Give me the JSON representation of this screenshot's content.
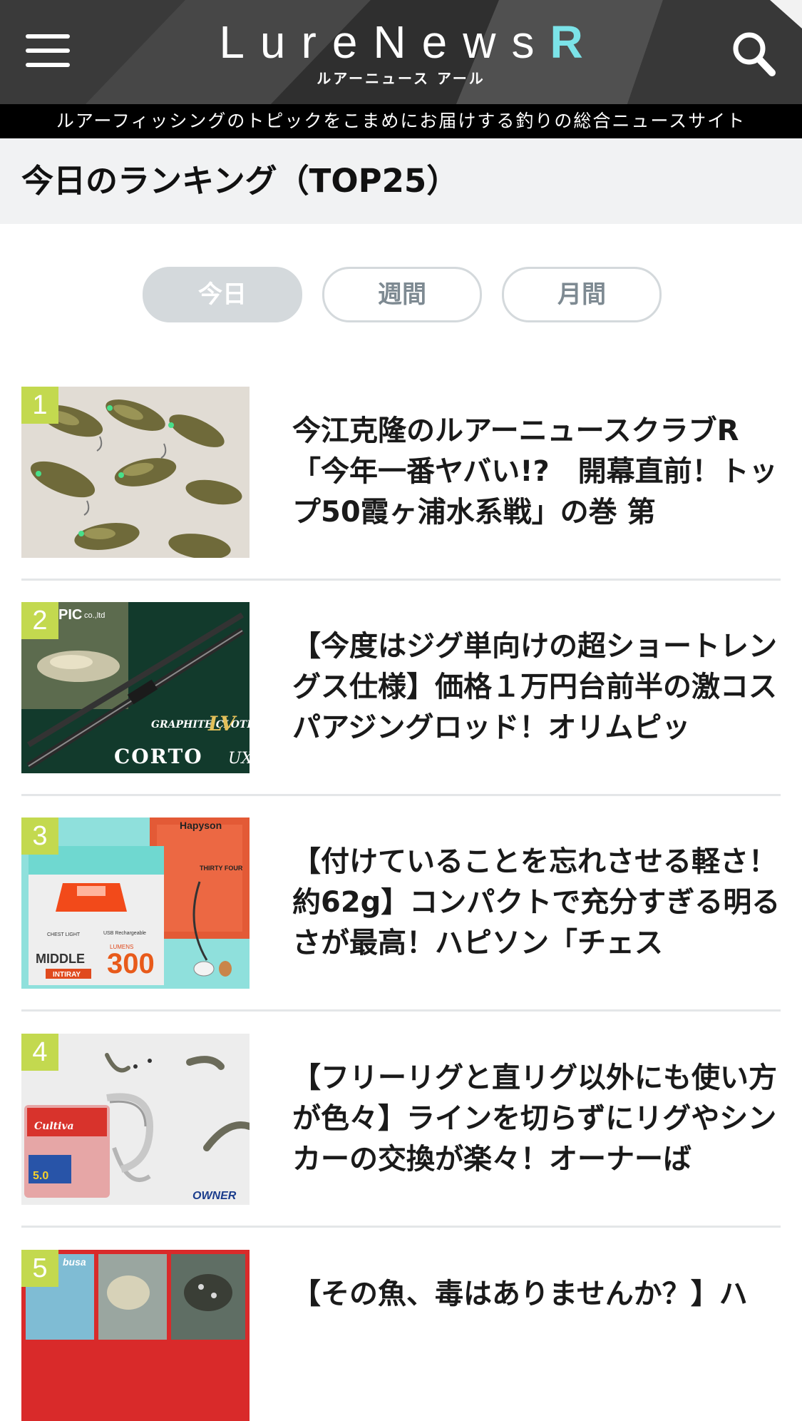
{
  "header": {
    "logo_text": "LureNews",
    "logo_r": "R",
    "logo_sub": "ルアーニュース アール",
    "tagline": "ルアーフィッシングのトピックをこまめにお届けする釣りの総合ニュースサイト",
    "menu_icon": "hamburger-icon",
    "search_icon": "search-icon"
  },
  "ranking": {
    "title": "今日のランキング（TOP25）",
    "tabs": [
      {
        "label": "今日",
        "active": true
      },
      {
        "label": "週間",
        "active": false
      },
      {
        "label": "月間",
        "active": false
      }
    ],
    "items": [
      {
        "rank": "1",
        "title": "今江克隆のルアーニュースクラブR「今年一番ヤバい!?　開幕直前！トップ50霞ヶ浦水系戦」の巻 第"
      },
      {
        "rank": "2",
        "title": "【今度はジグ単向けの超ショートレングス仕様】価格１万円台前半の激コスパアジングロッド！オリムピッ"
      },
      {
        "rank": "3",
        "title": "【付けていることを忘れさせる軽さ！約62g】コンパクトで充分すぎる明るさが最高！ハピソン「チェス"
      },
      {
        "rank": "4",
        "title": "【フリーリグと直リグ以外にも使い方が色々】ラインを切らずにリグやシンカーの交換が楽々！オーナーば"
      },
      {
        "rank": "5",
        "title": "【その魚、毒はありませんか？】ハ"
      }
    ]
  },
  "thumbs": {
    "item2_brand": "PIC",
    "item2_brand_suffix": "co.,ltd",
    "item2_series": "GRAPHITE CLOTH",
    "item2_series_mark": "LV",
    "item2_model": "CORTO",
    "item2_model_suffix": "UX",
    "item3_brand": "Hapyson",
    "item3_brand_sub": "THIRTY FOUR",
    "item3_label_middle": "MIDDLE",
    "item3_label_chest": "CHEST LIGHT",
    "item3_label_intiray": "INTIRAY",
    "item3_lumens": "300",
    "item3_lumens_label": "LUMENS",
    "item3_usb": "USB Rechargeable",
    "item4_brand": "OWNER",
    "item4_pack_brand": "Cultiva",
    "item4_pack_size": "5.0",
    "item5_brand": "busa"
  },
  "colors": {
    "rank_badge": "#c3d94f",
    "tab_active_bg": "#d4d9dc",
    "tab_text": "#7e8a92",
    "logo_accent": "#7be3e8",
    "section_bg": "#f1f2f3"
  }
}
